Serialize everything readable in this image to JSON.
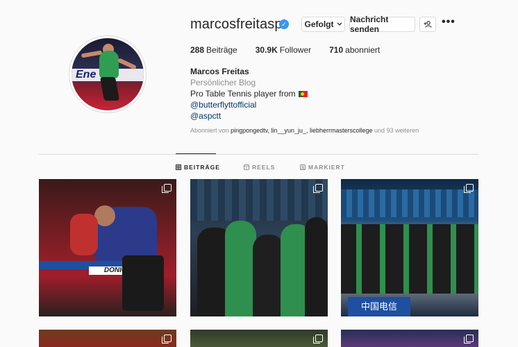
{
  "profile": {
    "username": "marcosfreitaspt",
    "full_name": "Marcos Freitas",
    "category": "Persönlicher Blog",
    "bio_text": "Pro Table Tennis player from",
    "link1": "@butterflyttofficial",
    "link2": "@aspctt",
    "followed_by_prefix": "Abonniert von",
    "followed_by_names": "pingpongedtv, lin__yun_ju_, liebherrmasterscollege",
    "followed_by_suffix": "und 93 weiteren"
  },
  "buttons": {
    "following": "Gefolgt",
    "message": "Nachricht senden",
    "more": "•••"
  },
  "stats": {
    "posts_count": "288",
    "posts_label": "Beiträge",
    "followers_count": "30.9K",
    "followers_label": "Follower",
    "following_count": "710",
    "following_label": "abonniert"
  },
  "tabs": {
    "posts": "BEITRÄGE",
    "reels": "REELS",
    "tagged": "MARKIERT"
  },
  "avatar_banner": "Ene",
  "post1_banner": "DONIC",
  "post3_banner": "中国电信",
  "colors": {
    "link": "#00376b",
    "verified": "#3897f0",
    "muted": "#8e8e8e"
  }
}
